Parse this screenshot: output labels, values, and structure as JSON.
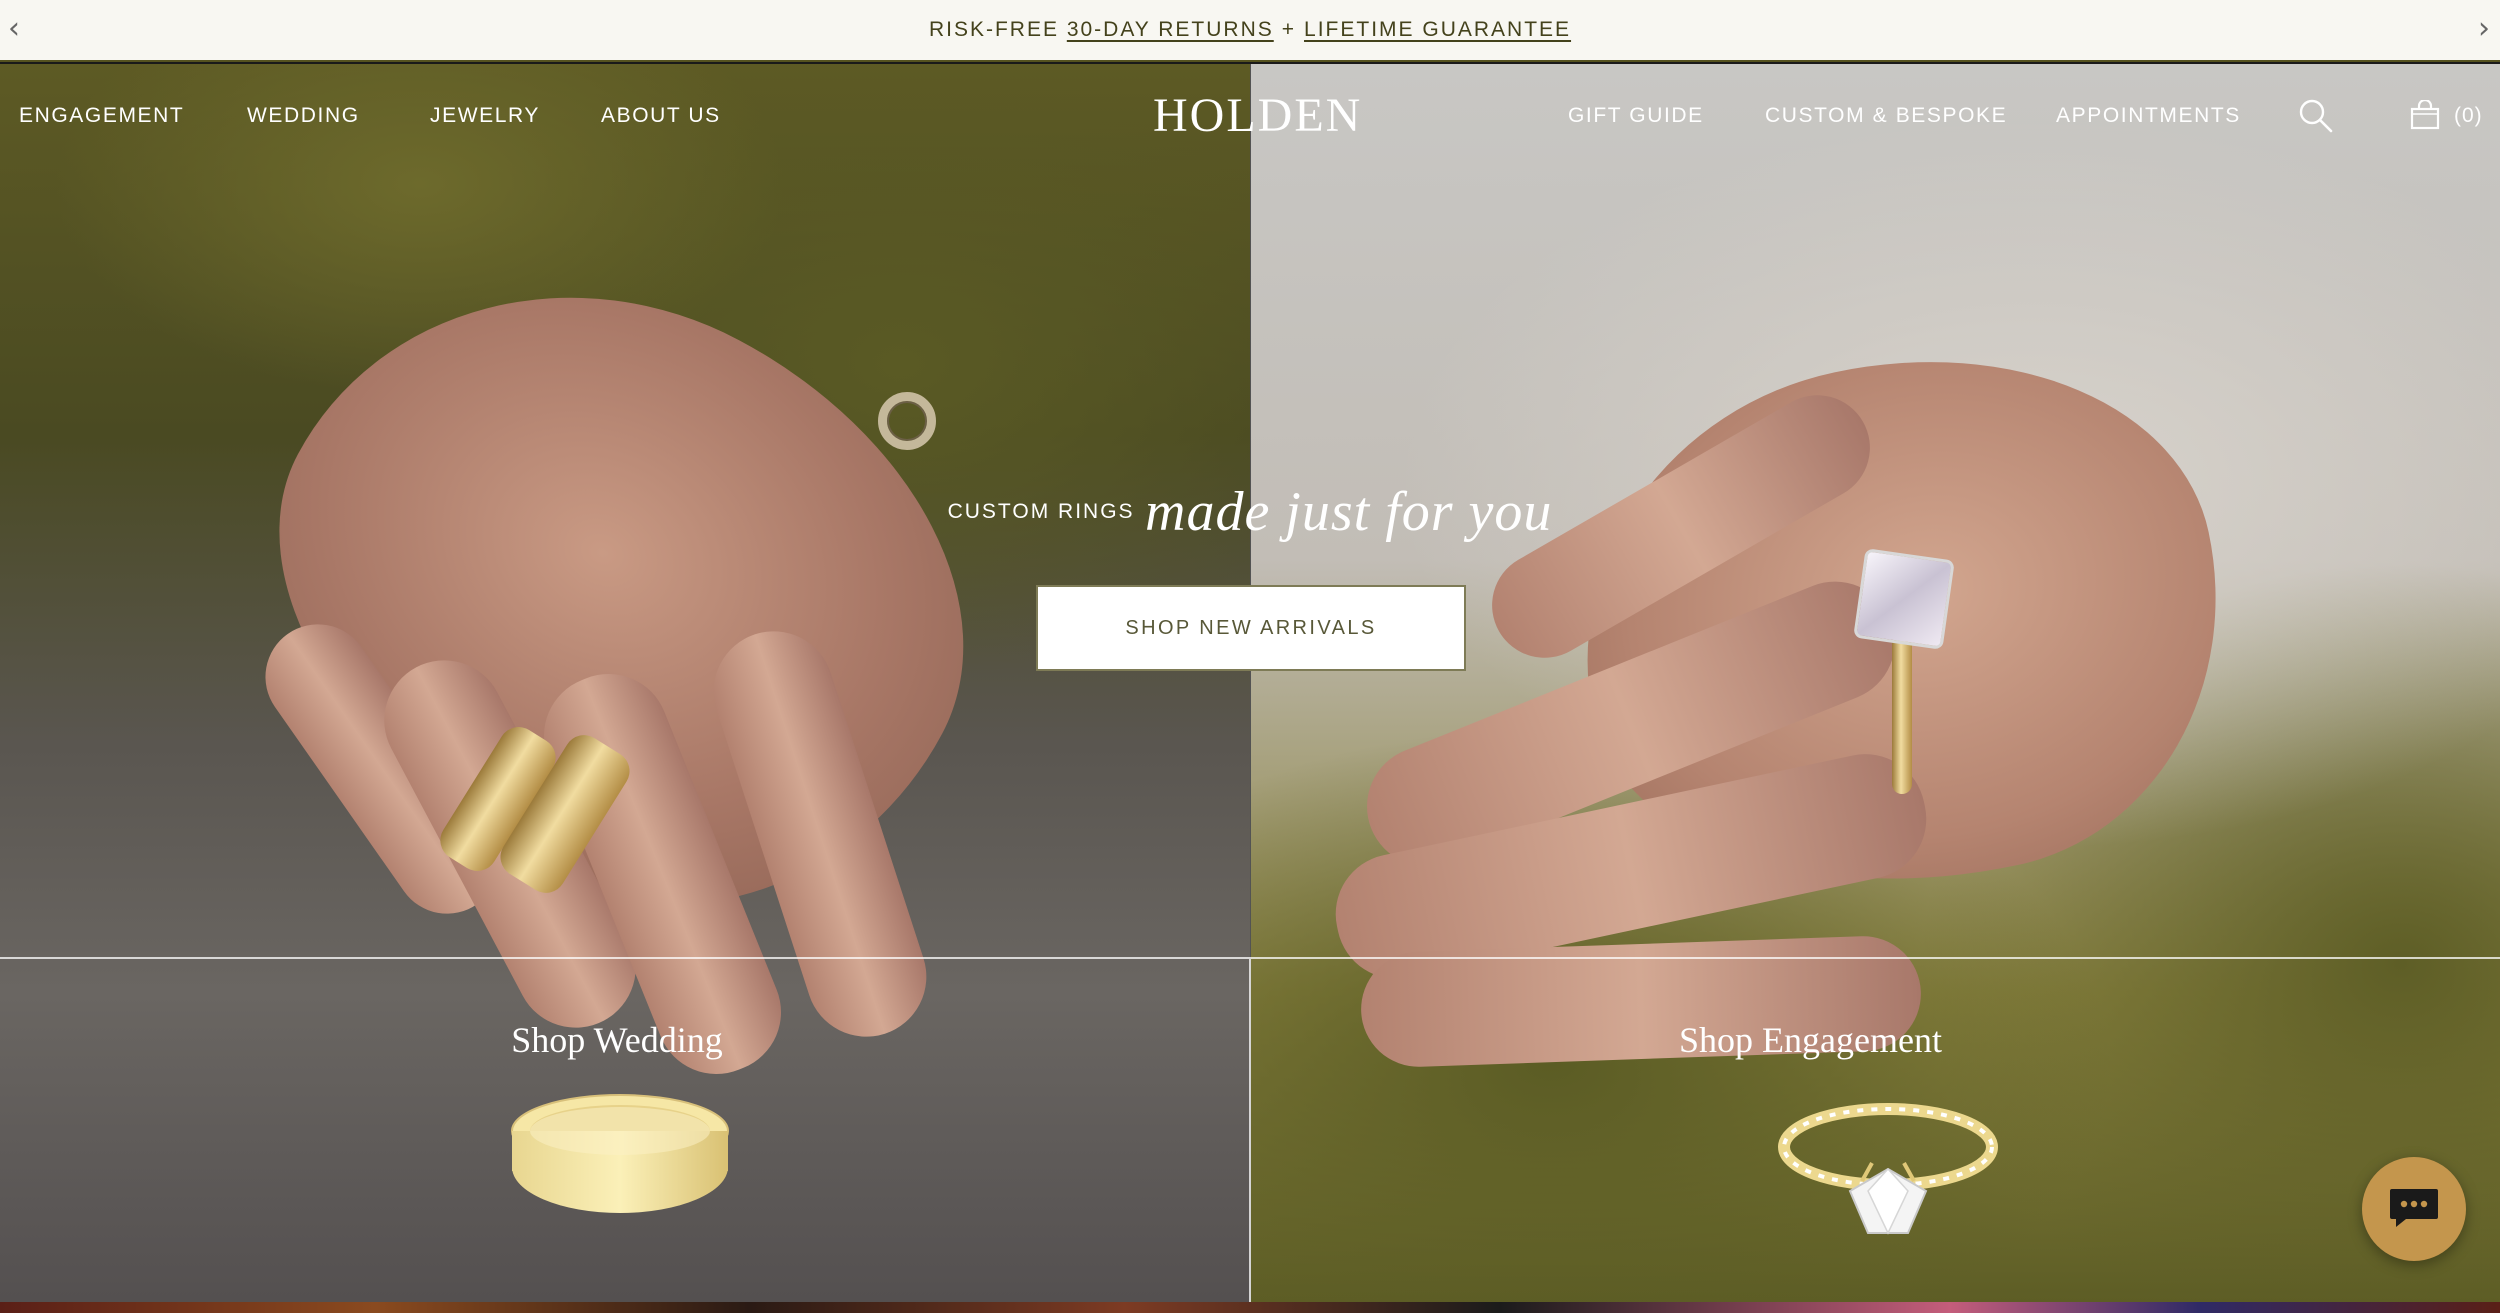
{
  "announcement": {
    "prefix": "RISK-FREE",
    "returns_link": "30-DAY RETURNS",
    "plus": "+",
    "guarantee_link": "LIFETIME GUARANTEE",
    "prev_arrow": "‹",
    "next_arrow": "›"
  },
  "nav": {
    "left_links": [
      "ENGAGEMENT",
      "WEDDING",
      "JEWELRY",
      "ABOUT US"
    ],
    "logo": "HOLDEN",
    "right_links": [
      "GIFT GUIDE",
      "CUSTOM & BESPOKE",
      "APPOINTMENTS"
    ],
    "search_icon": "search-icon",
    "cart_icon": "shopping-bag-icon",
    "cart_count": "(0)"
  },
  "hero": {
    "eyebrow": "CUSTOM RINGS",
    "script_text": "made just for you",
    "cta_label": "SHOP NEW ARRIVALS"
  },
  "categories": [
    {
      "title": "Shop Wedding",
      "icon": "gold-band-ring-icon"
    },
    {
      "title": "Shop Engagement",
      "icon": "diamond-solitaire-ring-icon"
    }
  ],
  "chat": {
    "icon": "chat-bubble-icon"
  },
  "colors": {
    "announcement_bg": "#f8f7f2",
    "announcement_text": "#44421c",
    "cta_text": "#585838",
    "chat_button": "#c4964d"
  }
}
